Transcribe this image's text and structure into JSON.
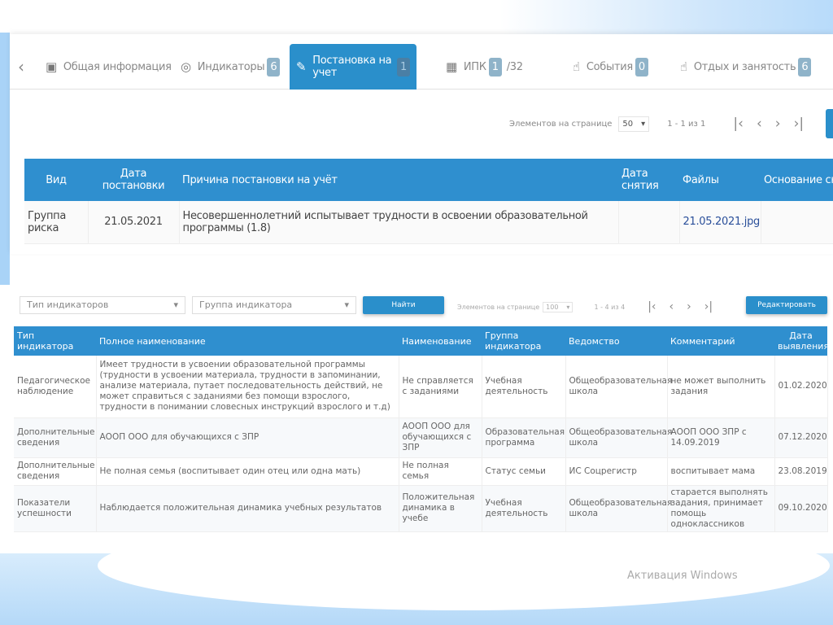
{
  "tabs": [
    {
      "icon": "back-chevron-icon",
      "glyph": "‹"
    },
    {
      "icon": "id-card-icon",
      "glyph": "▣",
      "label": "Общая информация"
    },
    {
      "icon": "target-icon",
      "glyph": "◎",
      "label": "Индикаторы",
      "badge": "6"
    },
    {
      "icon": "edit-icon",
      "glyph": "✎",
      "label": "Постановка на учет",
      "badge": "1"
    },
    {
      "icon": "calendar-icon",
      "glyph": "▦",
      "label": "ИПК",
      "badge": "1",
      "suffix": "/32"
    },
    {
      "icon": "hand-icon",
      "glyph": "☝",
      "label": "События",
      "badge": "0"
    },
    {
      "icon": "hand-icon",
      "glyph": "☝",
      "label": "Отдых и занятость",
      "badge": "6"
    }
  ],
  "pager1": {
    "label": "Элементов на странице",
    "per_page": "50",
    "range": "1 - 1 из 1"
  },
  "table1": {
    "headers": [
      "Вид",
      "Дата постановки",
      "Причина постановки на учёт",
      "Дата снятия",
      "Файлы",
      "Основание сня"
    ],
    "rows": [
      [
        "Группа риска",
        "21.05.2021",
        "Несовершеннолетний испытывает трудности в освоении образовательной программы (1.8)",
        "",
        "21.05.2021.jpg",
        ""
      ]
    ]
  },
  "filters": {
    "type_placeholder": "Тип индикаторов",
    "group_placeholder": "Группа индикатора",
    "find": "Найти",
    "per_page_label": "Элементов на странице",
    "per_page": "100",
    "range": "1 - 4 из 4",
    "edit": "Редактировать"
  },
  "table2": {
    "headers": [
      "Тип индикатора",
      "Полное наименование",
      "Наименование",
      "Группа индикатора",
      "Ведомство",
      "Комментарий",
      "Дата выявления"
    ],
    "rows": [
      [
        "Педагогическое наблюдение",
        "Имеет трудности в усвоении образовательной программы (трудности в усвоении материала, трудности в запоминании, анализе материала, путает последовательность действий, не может справиться с заданиями без помощи взрослого, трудности в понимании словесных инструкций взрослого и т.д)",
        "Не справляется с заданиями",
        "Учебная деятельность",
        "Общеобразовательная школа",
        "не может выполнить задания",
        "01.02.2020"
      ],
      [
        "Дополнительные сведения",
        "АООП ООО для обучающихся с ЗПР",
        "АООП ООО для обучающихся с ЗПР",
        "Образовательная программа",
        "Общеобразовательная школа",
        "АООП ООО ЗПР с 14.09.2019",
        "07.12.2020"
      ],
      [
        "Дополнительные сведения",
        "Не полная семья (воспитывает один отец или одна мать)",
        "Не полная семья",
        "Статус семьи",
        "ИС Соцрегистр",
        "воспитывает мама",
        "23.08.2019"
      ],
      [
        "Показатели успешности",
        "Наблюдается положительная динамика учебных результатов",
        "Положительная динамика в учебе",
        "Учебная деятельность",
        "Общеобразовательная школа",
        "старается выполнять задания, принимает помощь одноклассников",
        "09.10.2020"
      ]
    ]
  },
  "watermark": "Активация Windows"
}
